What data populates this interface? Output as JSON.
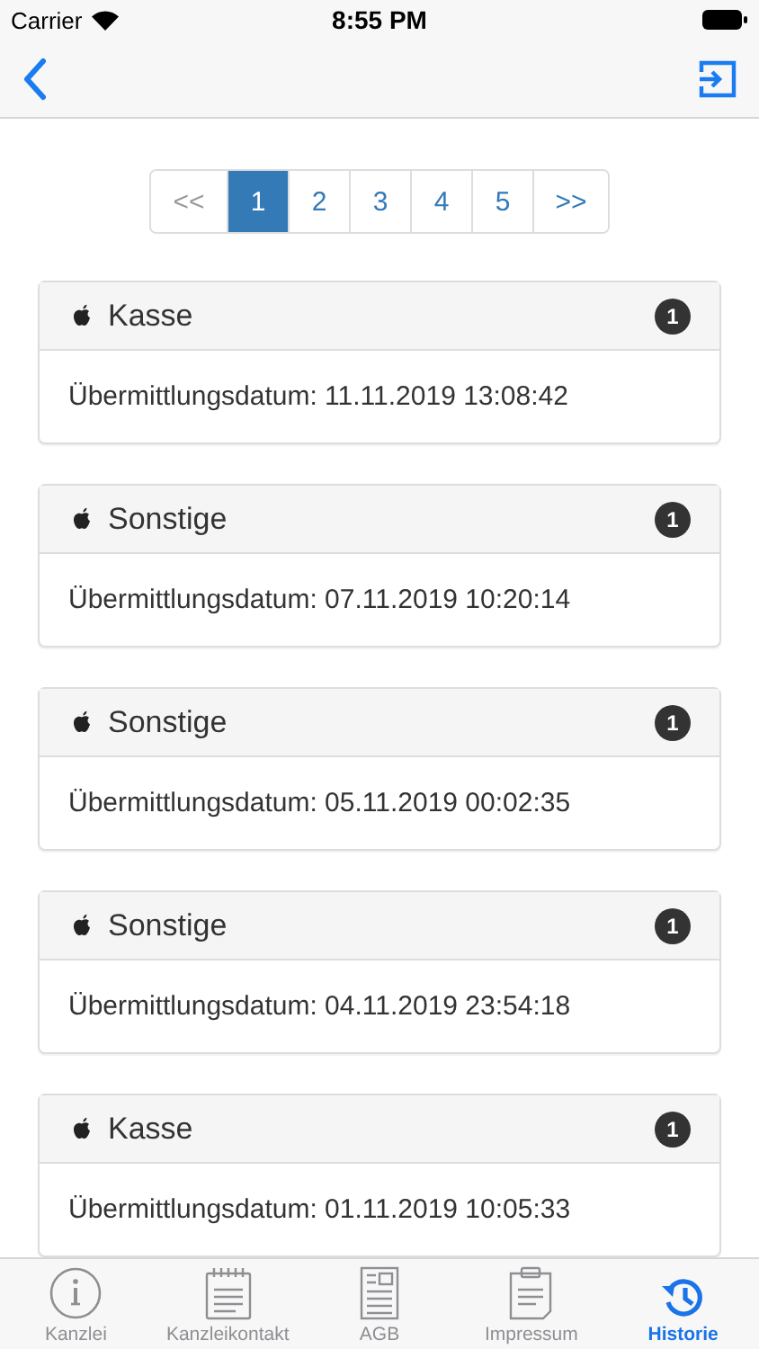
{
  "status_bar": {
    "carrier": "Carrier",
    "time": "8:55 PM"
  },
  "pagination": [
    {
      "label": "<<",
      "selected": false
    },
    {
      "label": "1",
      "selected": true
    },
    {
      "label": "2",
      "selected": false
    },
    {
      "label": "3",
      "selected": false
    },
    {
      "label": "4",
      "selected": false
    },
    {
      "label": "5",
      "selected": false
    },
    {
      "label": ">>",
      "selected": false
    }
  ],
  "entries": [
    {
      "title": "Kasse",
      "badge": "1",
      "detail": "Übermittlungsdatum: 11.11.2019 13:08:42"
    },
    {
      "title": "Sonstige",
      "badge": "1",
      "detail": "Übermittlungsdatum: 07.11.2019 10:20:14"
    },
    {
      "title": "Sonstige",
      "badge": "1",
      "detail": "Übermittlungsdatum: 05.11.2019 00:02:35"
    },
    {
      "title": "Sonstige",
      "badge": "1",
      "detail": "Übermittlungsdatum: 04.11.2019 23:54:18"
    },
    {
      "title": "Kasse",
      "badge": "1",
      "detail": "Übermittlungsdatum: 01.11.2019 10:05:33"
    }
  ],
  "tab_bar": [
    {
      "kind": "info",
      "label": "Kanzlei",
      "selected": false
    },
    {
      "kind": "notepad",
      "label": "Kanzleikontakt",
      "selected": false
    },
    {
      "kind": "document",
      "label": "AGB",
      "selected": false
    },
    {
      "kind": "clipboard",
      "label": "Impressum",
      "selected": false
    },
    {
      "kind": "history",
      "label": "Historie",
      "selected": true
    }
  ]
}
